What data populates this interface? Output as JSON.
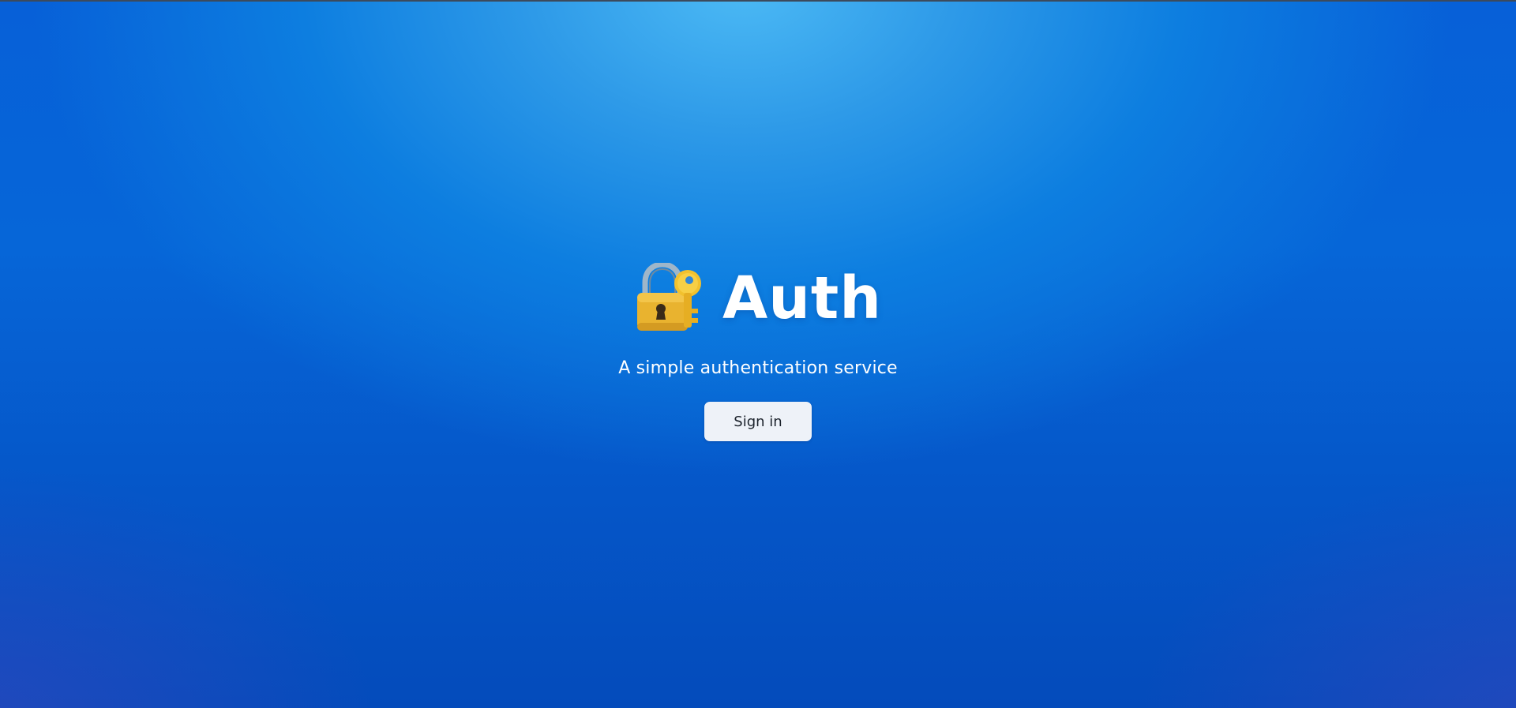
{
  "app": {
    "title": "Auth",
    "subtitle": "A simple authentication service",
    "logo_icon": "locked-with-key-icon"
  },
  "actions": {
    "sign_in_label": "Sign in"
  },
  "colors": {
    "background_primary": "#0666d8",
    "background_highlight": "#4cbaf5",
    "button_background": "#eef2f8",
    "button_text": "#1c232c",
    "title_text": "#ffffff"
  }
}
